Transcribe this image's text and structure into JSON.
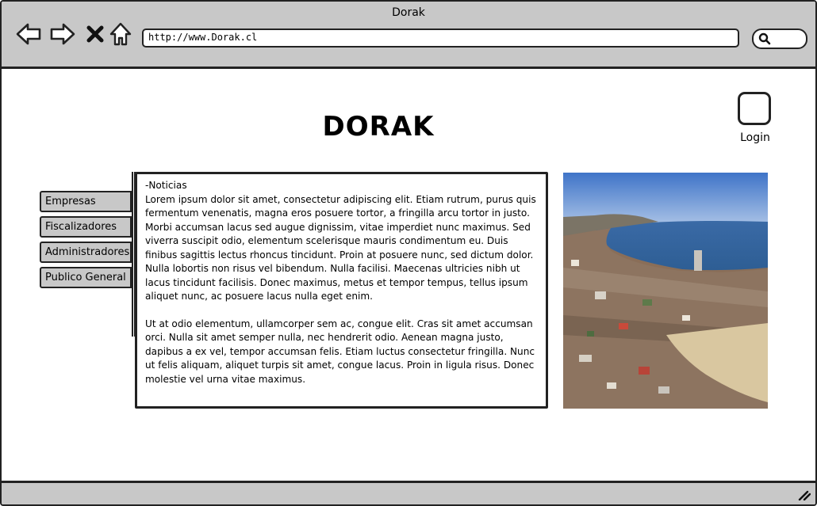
{
  "window": {
    "title": "Dorak"
  },
  "toolbar": {
    "url": "http://www.Dorak.cl"
  },
  "header": {
    "title": "DORAK",
    "login_label": "Login"
  },
  "sidebar": {
    "items": [
      {
        "label": "Empresas"
      },
      {
        "label": "Fiscalizadores"
      },
      {
        "label": "Administradores"
      },
      {
        "label": "Publico General"
      }
    ]
  },
  "news": {
    "heading": "-Noticias",
    "paragraphs": [
      "Lorem ipsum dolor sit amet, consectetur adipiscing elit. Etiam rutrum, purus quis fermentum venenatis, magna eros posuere tortor, a fringilla arcu tortor in justo. Morbi accumsan lacus sed augue dignissim, vitae imperdiet nunc maximus. Sed viverra suscipit odio, elementum scelerisque mauris condimentum eu. Duis finibus sagittis lectus rhoncus tincidunt. Proin at posuere nunc, sed dictum dolor. Nulla lobortis non risus vel bibendum. Nulla facilisi. Maecenas ultricies nibh ut lacus tincidunt facilisis. Donec maximus, metus et tempor tempus, tellus ipsum aliquet nunc, ac posuere lacus nulla eget enim.",
      "Ut at odio elementum, ullamcorper sem ac, congue elit. Cras sit amet accumsan orci. Nulla sit amet semper nulla, nec hendrerit odio. Aenean magna justo, dapibus a ex vel, tempor accumsan felis. Etiam luctus consectetur fringilla. Nunc ut felis aliquam, aliquet turpis sit amet, congue lacus. Proin in ligula risus. Donec molestie vel urna vitae maximus."
    ]
  },
  "icons": {
    "back": "back-arrow-icon",
    "forward": "forward-arrow-icon",
    "stop": "close-icon",
    "home": "home-icon",
    "search": "search-icon",
    "resize": "resize-grip-icon"
  },
  "colors": {
    "chrome": "#c8c8c8",
    "outline": "#222222",
    "background": "#ffffff"
  }
}
